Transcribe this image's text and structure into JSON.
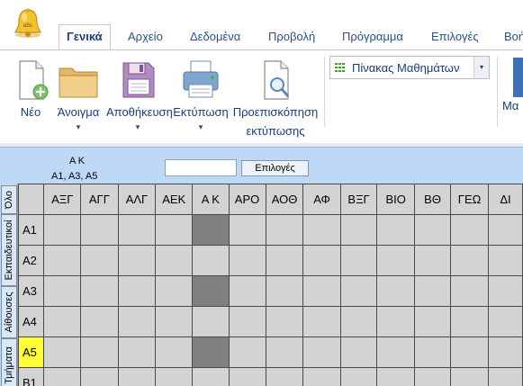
{
  "tabs": [
    {
      "label": "Γενικά",
      "active": true
    },
    {
      "label": "Αρχείο"
    },
    {
      "label": "Δεδομένα"
    },
    {
      "label": "Προβολή"
    },
    {
      "label": "Πρόγραμμα"
    },
    {
      "label": "Επιλογές"
    },
    {
      "label": "Βοή"
    }
  ],
  "ribbon": {
    "new": "Νέο",
    "open": "Άνοιγμα",
    "save": "Αποθήκευση",
    "print": "Εκτύπωση",
    "preview_line1": "Προεπισκόπηση",
    "preview_line2": "εκτύπωσης",
    "dropdown_arrow": "▾",
    "combo_value": "Πίνακας Μαθημάτων",
    "combo_arrow": "▾",
    "right_label": "Μα"
  },
  "selection": {
    "title": "Α Κ",
    "classes": "Α1, Α3, Α5"
  },
  "filter": {
    "input_value": "",
    "button_label": "Επιλογές"
  },
  "side_tabs": [
    "Όλο",
    "Εκπαιδευτικοί",
    "Αίθουσες",
    "Τμήματα"
  ],
  "grid": {
    "columns": [
      "ΑΞΓ",
      "ΑΓΓ",
      "ΑΛΓ",
      "ΑΕΚ",
      "Α Κ",
      "ΑΡΟ",
      "ΑΟΘ",
      "ΑΦ",
      "ΒΞΓ",
      "ΒΙΟ",
      "ΒΘ",
      "ΓΕΩ",
      "ΔΙ"
    ],
    "rows": [
      {
        "label": "Α1",
        "filled_col": 4,
        "highlight": false
      },
      {
        "label": "Α2",
        "filled_col": -1,
        "highlight": false
      },
      {
        "label": "Α3",
        "filled_col": 4,
        "highlight": false
      },
      {
        "label": "Α4",
        "filled_col": -1,
        "highlight": false
      },
      {
        "label": "Α5",
        "filled_col": 4,
        "highlight": true
      },
      {
        "label": "Β1",
        "filled_col": -1,
        "highlight": false
      }
    ]
  }
}
